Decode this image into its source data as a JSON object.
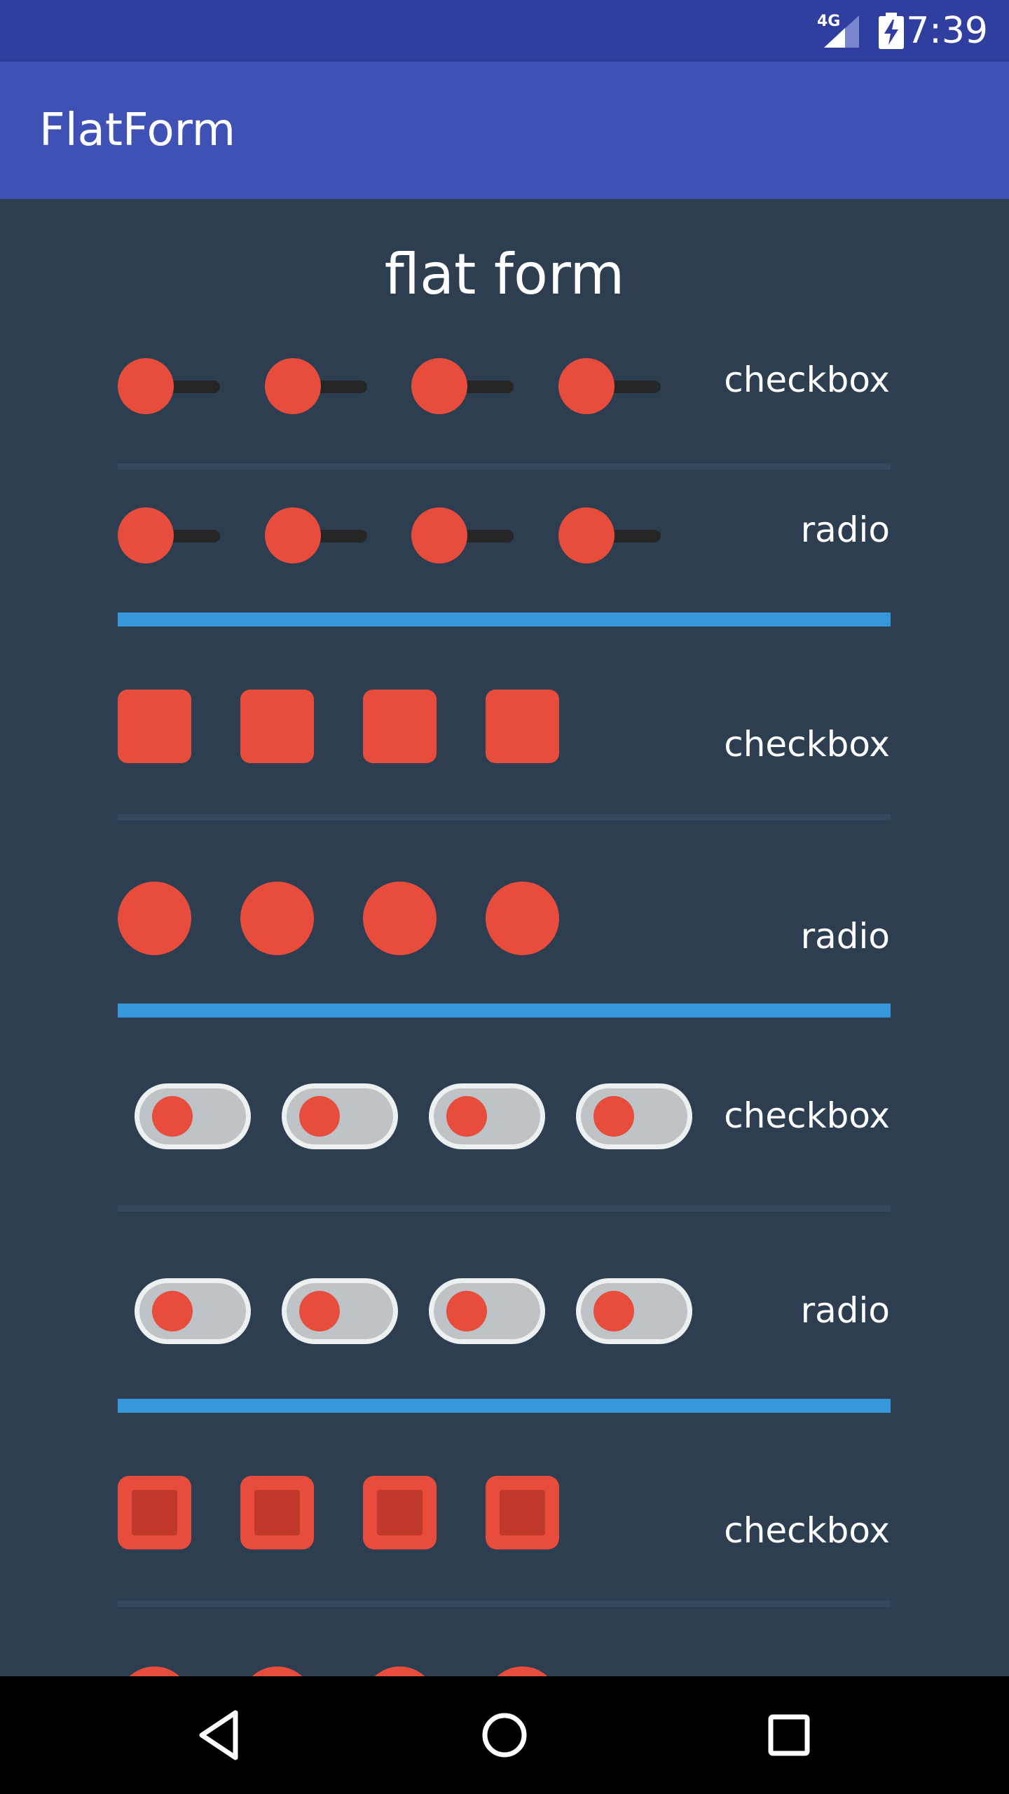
{
  "status_bar": {
    "time": "7:39",
    "network": "4G",
    "icons": [
      "signal-icon",
      "battery-charging-icon"
    ]
  },
  "app_bar": {
    "title": "FlatForm"
  },
  "content": {
    "heading": "flat form",
    "sections": [
      {
        "style": "slider",
        "rows": [
          {
            "label": "checkbox"
          },
          {
            "label": "radio"
          }
        ]
      },
      {
        "style": "flat",
        "rows": [
          {
            "label": "checkbox"
          },
          {
            "label": "radio"
          }
        ]
      },
      {
        "style": "pill",
        "rows": [
          {
            "label": "checkbox"
          },
          {
            "label": "radio"
          }
        ]
      },
      {
        "style": "framed",
        "rows": [
          {
            "label": "checkbox"
          }
        ]
      }
    ]
  },
  "nav_bar": {
    "icons": [
      "back-icon",
      "home-icon",
      "recents-icon"
    ]
  },
  "colors": {
    "background": "#2c3e50",
    "accent": "#e74c3c",
    "accent_dark": "#c0392b",
    "divider": "#34495e",
    "section_divider": "#3498db",
    "app_bar": "#3f51b5",
    "status_bar": "#303f9f"
  }
}
